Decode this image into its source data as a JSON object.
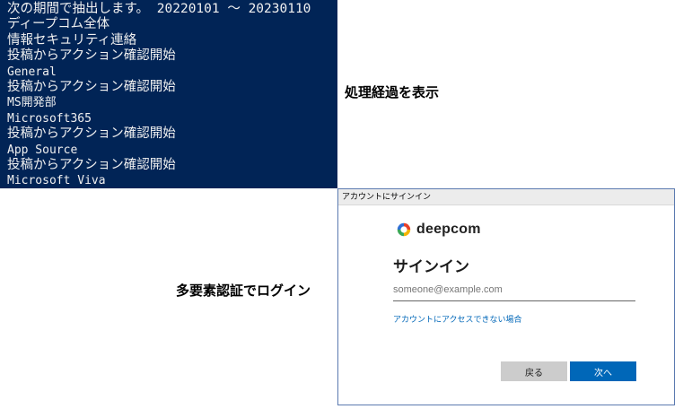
{
  "console": {
    "lines": [
      {
        "text": "次の期間で抽出します。 20220101 ～ 20230110",
        "kind": "jp"
      },
      {
        "text": "ディープコム全体",
        "kind": "jp"
      },
      {
        "text": "情報セキュリティ連絡",
        "kind": "jp"
      },
      {
        "text": "投稿からアクション確認開始",
        "kind": "jp"
      },
      {
        "text": "General",
        "kind": "en"
      },
      {
        "text": "投稿からアクション確認開始",
        "kind": "jp"
      },
      {
        "text": "MS開発部",
        "kind": "en"
      },
      {
        "text": "Microsoft365",
        "kind": "en"
      },
      {
        "text": "投稿からアクション確認開始",
        "kind": "jp"
      },
      {
        "text": "App Source",
        "kind": "en"
      },
      {
        "text": "投稿からアクション確認開始",
        "kind": "jp"
      },
      {
        "text": "Microsoft Viva",
        "kind": "en"
      }
    ]
  },
  "captions": {
    "progress": "処理経過を表示",
    "mfa_login": "多要素認証でログイン"
  },
  "dialog": {
    "window_title": "アカウントにサインイン",
    "brand_name": "deepcom",
    "heading": "サインイン",
    "email_placeholder": "someone@example.com",
    "no_access_link": "アカウントにアクセスできない場合",
    "back_label": "戻る",
    "next_label": "次へ"
  },
  "colors": {
    "console_bg": "#012456",
    "accent": "#0067b8",
    "back_button": "#cccccc"
  },
  "icons": {
    "brand_logo": "deepcom-logo-icon"
  }
}
